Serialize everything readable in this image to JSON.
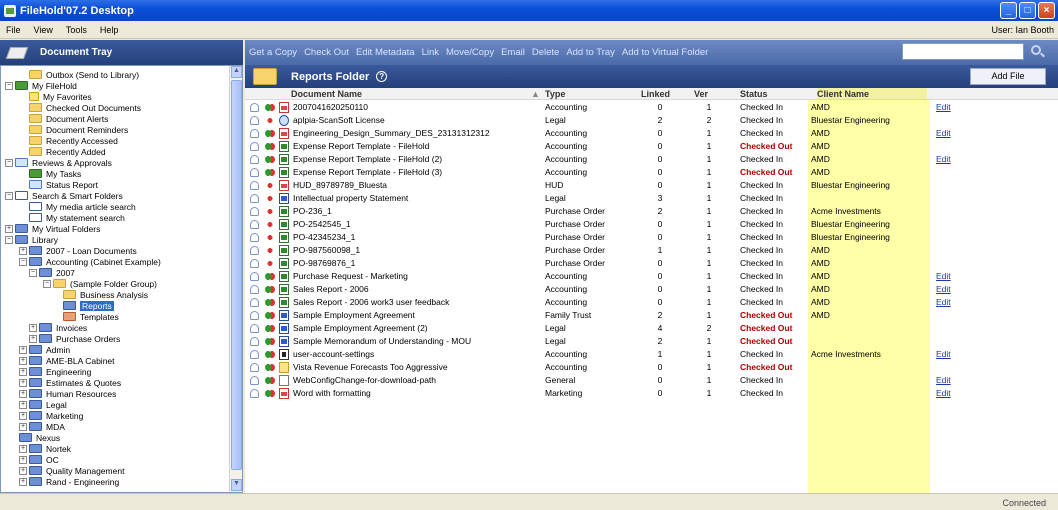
{
  "window": {
    "title": "FileHold'07.2 Desktop"
  },
  "menu": {
    "items": [
      "File",
      "View",
      "Tools",
      "Help"
    ],
    "user": "User: Ian Booth"
  },
  "tray": {
    "title": "Document Tray"
  },
  "toolbar": {
    "links": [
      "Get a Copy",
      "Check Out",
      "Edit Metadata",
      "Link",
      "Move/Copy",
      "Email",
      "Delete",
      "Add to Tray",
      "Add to Virtual Folder"
    ],
    "search_value": ""
  },
  "tree": [
    {
      "label": "Outbox (Send to Library)",
      "icon": "folder",
      "level": 2,
      "exp": ""
    },
    {
      "label": "My FileHold",
      "icon": "people",
      "level": 0,
      "exp": "-"
    },
    {
      "label": "My Favorites",
      "icon": "star",
      "level": 2,
      "exp": ""
    },
    {
      "label": "Checked Out Documents",
      "icon": "folder",
      "level": 2,
      "exp": ""
    },
    {
      "label": "Document Alerts",
      "icon": "folder",
      "level": 2,
      "exp": ""
    },
    {
      "label": "Document Reminders",
      "icon": "folder",
      "level": 2,
      "exp": ""
    },
    {
      "label": "Recently Accessed",
      "icon": "folder",
      "level": 2,
      "exp": ""
    },
    {
      "label": "Recently Added",
      "icon": "folder",
      "level": 2,
      "exp": ""
    },
    {
      "label": "Reviews & Approvals",
      "icon": "check",
      "level": 0,
      "exp": "-"
    },
    {
      "label": "My Tasks",
      "icon": "people",
      "level": 2,
      "exp": ""
    },
    {
      "label": "Status Report",
      "icon": "check",
      "level": 2,
      "exp": ""
    },
    {
      "label": "Search & Smart Folders",
      "icon": "search",
      "level": 0,
      "exp": "-"
    },
    {
      "label": "My media article search",
      "icon": "search",
      "level": 2,
      "exp": ""
    },
    {
      "label": "My statement search",
      "icon": "search",
      "level": 2,
      "exp": ""
    },
    {
      "label": "My Virtual Folders",
      "icon": "blue",
      "level": 0,
      "exp": "+"
    },
    {
      "label": "Library",
      "icon": "blue",
      "level": 0,
      "exp": "-"
    },
    {
      "label": "2007 - Loan Documents",
      "icon": "blue",
      "level": 1,
      "exp": "+"
    },
    {
      "label": "Accounting (Cabinet Example)",
      "icon": "blue",
      "level": 1,
      "exp": "-"
    },
    {
      "label": "2007",
      "icon": "blue",
      "level": 2,
      "exp": "-"
    },
    {
      "label": "(Sample Folder Group)",
      "icon": "folder",
      "level": 3,
      "exp": "-"
    },
    {
      "label": "Business Analysis",
      "icon": "folder",
      "level": 4,
      "exp": ""
    },
    {
      "label": "Reports",
      "icon": "blue",
      "level": 4,
      "exp": "",
      "selected": true
    },
    {
      "label": "Templates",
      "icon": "red",
      "level": 4,
      "exp": ""
    },
    {
      "label": "Invoices",
      "icon": "blue",
      "level": 2,
      "exp": "+"
    },
    {
      "label": "Purchase Orders",
      "icon": "blue",
      "level": 2,
      "exp": "+"
    },
    {
      "label": "Admin",
      "icon": "blue",
      "level": 1,
      "exp": "+"
    },
    {
      "label": "AME-BLA Cabinet",
      "icon": "blue",
      "level": 1,
      "exp": "+"
    },
    {
      "label": "Engineering",
      "icon": "blue",
      "level": 1,
      "exp": "+"
    },
    {
      "label": "Estimates & Quotes",
      "icon": "blue",
      "level": 1,
      "exp": "+"
    },
    {
      "label": "Human Resources",
      "icon": "blue",
      "level": 1,
      "exp": "+"
    },
    {
      "label": "Legal",
      "icon": "blue",
      "level": 1,
      "exp": "+"
    },
    {
      "label": "Marketing",
      "icon": "blue",
      "level": 1,
      "exp": "+"
    },
    {
      "label": "MDA",
      "icon": "blue",
      "level": 1,
      "exp": "+"
    },
    {
      "label": "Nexus",
      "icon": "blue",
      "level": 1,
      "exp": ""
    },
    {
      "label": "Nortek",
      "icon": "blue",
      "level": 1,
      "exp": "+"
    },
    {
      "label": "OC",
      "icon": "blue",
      "level": 1,
      "exp": "+"
    },
    {
      "label": "Quality Management",
      "icon": "blue",
      "level": 1,
      "exp": "+"
    },
    {
      "label": "Rand - Engineering",
      "icon": "blue",
      "level": 1,
      "exp": "+"
    }
  ],
  "folder": {
    "title": "Reports Folder",
    "add_file": "Add File"
  },
  "columns": [
    "Document Name",
    "Type",
    "Linked",
    "Ver",
    "Status",
    "Client Name"
  ],
  "rows": [
    {
      "icon": "pdf",
      "state": "both",
      "name": "2007041620250110",
      "type": "Accounting",
      "linked": "0",
      "ver": "1",
      "status": "Checked In",
      "client": "AMD",
      "edit": "Edit"
    },
    {
      "icon": "scan",
      "state": "red",
      "name": "aplpia-ScanSoft License",
      "type": "Legal",
      "linked": "2",
      "ver": "2",
      "status": "Checked In",
      "client": "Bluestar Engineering",
      "edit": ""
    },
    {
      "icon": "pdf",
      "state": "both",
      "name": "Engineering_Design_Summary_DES_23131312312",
      "type": "Accounting",
      "linked": "0",
      "ver": "1",
      "status": "Checked In",
      "client": "AMD",
      "edit": "Edit"
    },
    {
      "icon": "xls",
      "state": "both",
      "name": "Expense Report Template - FileHold",
      "type": "Accounting",
      "linked": "0",
      "ver": "1",
      "status": "Checked Out",
      "client": "AMD",
      "edit": ""
    },
    {
      "icon": "xls",
      "state": "both",
      "name": "Expense Report Template - FileHold (2)",
      "type": "Accounting",
      "linked": "0",
      "ver": "1",
      "status": "Checked In",
      "client": "AMD",
      "edit": "Edit"
    },
    {
      "icon": "xls",
      "state": "both",
      "name": "Expense Report Template - FileHold (3)",
      "type": "Accounting",
      "linked": "0",
      "ver": "1",
      "status": "Checked Out",
      "client": "AMD",
      "edit": ""
    },
    {
      "icon": "pdf",
      "state": "red",
      "name": "HUD_89789789_Bluesta",
      "type": "HUD",
      "linked": "0",
      "ver": "1",
      "status": "Checked In",
      "client": "Bluestar Engineering",
      "edit": ""
    },
    {
      "icon": "doc",
      "state": "red",
      "name": "Intellectual property Statement",
      "type": "Legal",
      "linked": "3",
      "ver": "1",
      "status": "Checked In",
      "client": "",
      "edit": ""
    },
    {
      "icon": "xls",
      "state": "red",
      "name": "PO-236_1",
      "type": "Purchase Order",
      "linked": "2",
      "ver": "1",
      "status": "Checked In",
      "client": "Acme Investments",
      "edit": ""
    },
    {
      "icon": "xls",
      "state": "red",
      "name": "PO-2542545_1",
      "type": "Purchase Order",
      "linked": "0",
      "ver": "1",
      "status": "Checked In",
      "client": "Bluestar Engineering",
      "edit": ""
    },
    {
      "icon": "xls",
      "state": "red",
      "name": "PO-42345234_1",
      "type": "Purchase Order",
      "linked": "0",
      "ver": "1",
      "status": "Checked In",
      "client": "Bluestar Engineering",
      "edit": ""
    },
    {
      "icon": "xls",
      "state": "red",
      "name": "PO-987560098_1",
      "type": "Purchase Order",
      "linked": "1",
      "ver": "1",
      "status": "Checked In",
      "client": "AMD",
      "edit": ""
    },
    {
      "icon": "xls",
      "state": "red",
      "name": "PO-98769876_1",
      "type": "Purchase Order",
      "linked": "0",
      "ver": "1",
      "status": "Checked In",
      "client": "AMD",
      "edit": ""
    },
    {
      "icon": "xls",
      "state": "both",
      "name": "Purchase Request - Marketing",
      "type": "Accounting",
      "linked": "0",
      "ver": "1",
      "status": "Checked In",
      "client": "AMD",
      "edit": "Edit"
    },
    {
      "icon": "xls",
      "state": "both",
      "name": "Sales Report - 2006",
      "type": "Accounting",
      "linked": "0",
      "ver": "1",
      "status": "Checked In",
      "client": "AMD",
      "edit": "Edit"
    },
    {
      "icon": "xls",
      "state": "both",
      "name": "Sales Report - 2006 work3 user feedback",
      "type": "Accounting",
      "linked": "0",
      "ver": "1",
      "status": "Checked In",
      "client": "AMD",
      "edit": "Edit"
    },
    {
      "icon": "doc",
      "state": "both",
      "name": "Sample Employment Agreement",
      "type": "Family Trust",
      "linked": "2",
      "ver": "1",
      "status": "Checked Out",
      "client": "AMD",
      "edit": ""
    },
    {
      "icon": "doc",
      "state": "both",
      "name": "Sample Employment Agreement (2)",
      "type": "Legal",
      "linked": "4",
      "ver": "2",
      "status": "Checked Out",
      "client": "",
      "edit": ""
    },
    {
      "icon": "doc",
      "state": "both",
      "name": "Sample Memorandum of Understanding - MOU",
      "type": "Legal",
      "linked": "2",
      "ver": "1",
      "status": "Checked Out",
      "client": "",
      "edit": ""
    },
    {
      "icon": "settings",
      "state": "both",
      "name": "user-account-settings",
      "type": "Accounting",
      "linked": "1",
      "ver": "1",
      "status": "Checked In",
      "client": "Acme Investments",
      "edit": "Edit"
    },
    {
      "icon": "mail",
      "state": "both",
      "name": "Vista Revenue Forecasts Too Aggressive",
      "type": "Accounting",
      "linked": "0",
      "ver": "1",
      "status": "Checked Out",
      "client": "",
      "edit": ""
    },
    {
      "icon": "blank",
      "state": "both",
      "name": "WebConfigChange-for-download-path",
      "type": "General",
      "linked": "0",
      "ver": "1",
      "status": "Checked In",
      "client": "",
      "edit": "Edit"
    },
    {
      "icon": "pdf",
      "state": "both",
      "name": "Word with formatting",
      "type": "Marketing",
      "linked": "0",
      "ver": "1",
      "status": "Checked In",
      "client": "",
      "edit": "Edit"
    }
  ],
  "status_bar": {
    "connection": "Connected"
  },
  "colors": {
    "accent": "#24407a",
    "client_highlight": "#ffffa8",
    "checked_out": "#b00000"
  }
}
